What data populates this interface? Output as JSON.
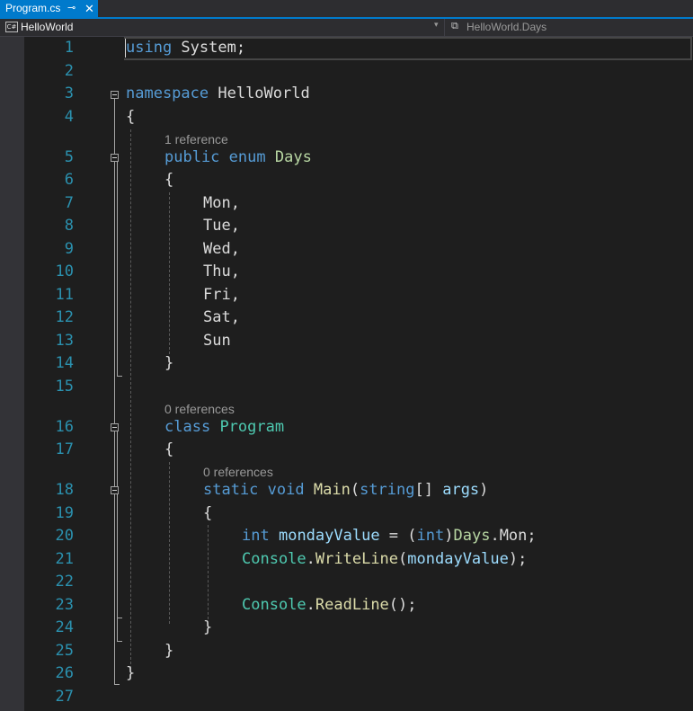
{
  "tab": {
    "title": "Program.cs",
    "pin": "⊸",
    "close": "✕"
  },
  "navbar": {
    "project_icon": "C#",
    "project": "HelloWorld",
    "dropdown": "▾",
    "member_icon": "⧉",
    "member": "HelloWorld.Days"
  },
  "line_numbers": [
    "1",
    "2",
    "3",
    "4",
    "5",
    "6",
    "7",
    "8",
    "9",
    "10",
    "11",
    "12",
    "13",
    "14",
    "15",
    "16",
    "17",
    "18",
    "19",
    "20",
    "21",
    "22",
    "23",
    "24",
    "25",
    "26",
    "27"
  ],
  "codelens": {
    "days": "1 reference",
    "program": "0 references",
    "main": "0 references"
  },
  "code": {
    "l1": {
      "kw": "using",
      "rest": " System;"
    },
    "l3": {
      "kw": "namespace",
      "rest": " HelloWorld"
    },
    "l4": "{",
    "l5": {
      "kw1": "public",
      "kw2": "enum",
      "name": "Days"
    },
    "l6": "{",
    "l7": "Mon,",
    "l8": "Tue,",
    "l9": "Wed,",
    "l10": "Thu,",
    "l11": "Fri,",
    "l12": "Sat,",
    "l13": "Sun",
    "l14": "}",
    "l16": {
      "kw": "class",
      "name": "Program"
    },
    "l17": "{",
    "l18": {
      "kw1": "static",
      "kw2": "void",
      "fn": "Main",
      "p1": "(",
      "type": "string",
      "p2": "[] ",
      "param": "args",
      "p3": ")"
    },
    "l19": "{",
    "l20": {
      "kw": "int",
      "var": "mondayValue",
      "eq": " = (",
      "cast": "int",
      "cl": ")",
      "en": "Days",
      "dot": ".",
      "mem": "Mon",
      "end": ";"
    },
    "l21": {
      "cls": "Console",
      "dot": ".",
      "fn": "WriteLine",
      "p1": "(",
      "var": "mondayValue",
      "p2": ");"
    },
    "l23": {
      "cls": "Console",
      "dot": ".",
      "fn": "ReadLine",
      "p": "();"
    },
    "l24": "}",
    "l25": "}",
    "l26": "}"
  }
}
